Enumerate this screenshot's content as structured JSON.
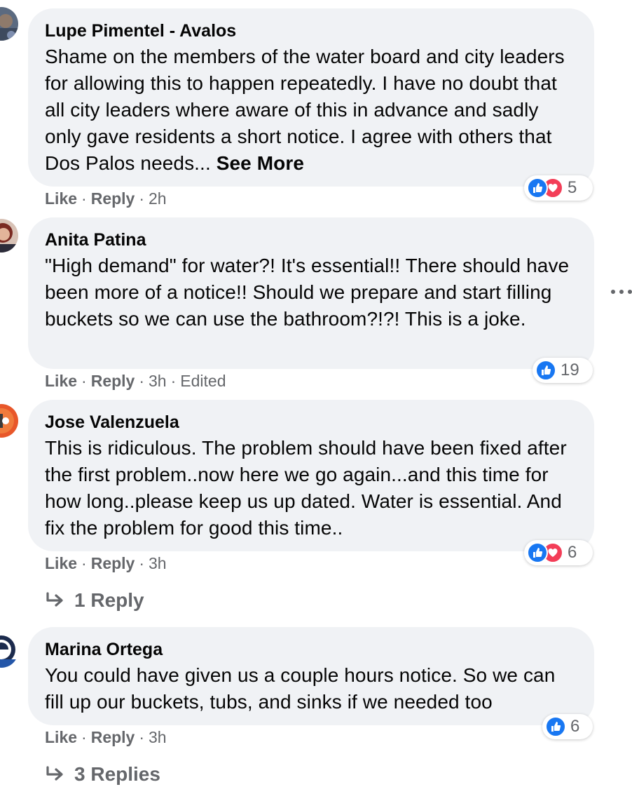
{
  "colors": {
    "bubble": "#f0f2f5",
    "meta_text": "#65676b",
    "like_blue": "#1877f2",
    "love_red": "#f33e58"
  },
  "comments": [
    {
      "author": "Lupe Pimentel - Avalos",
      "text": "Shame on the members of the water board and city leaders for allowing this to happen repeatedly. I have no doubt that all city leaders where aware of this in advance and sadly only gave residents a short notice. I agree with others that Dos Palos needs...",
      "see_more": "See More",
      "like": "Like",
      "reply": "Reply",
      "time": "2h",
      "reactions": [
        "like-icon",
        "love-icon"
      ],
      "reaction_count": "5"
    },
    {
      "author": "Anita Patina",
      "text": "\"High demand\" for water?! It's essential!! There should have been more of a notice!! Should we prepare and start filling buckets so we can use the bathroom?!?! This is a joke.",
      "like": "Like",
      "reply": "Reply",
      "time": "3h",
      "edited": "Edited",
      "reactions": [
        "like-icon"
      ],
      "reaction_count": "19"
    },
    {
      "author": "Jose Valenzuela",
      "text": "This is ridiculous. The problem should have been fixed after the first problem..now here we go again...and this time for how long..please keep us up dated. Water is essential. And fix the problem for good this time..",
      "like": "Like",
      "reply": "Reply",
      "time": "3h",
      "reactions": [
        "like-icon",
        "love-icon"
      ],
      "reaction_count": "6",
      "replies_label": "1 Reply"
    },
    {
      "author": "Marina Ortega",
      "text": "You could have given us a couple hours notice. So we can fill up our buckets, tubs, and sinks if we needed too",
      "like": "Like",
      "reply": "Reply",
      "time": "3h",
      "reactions": [
        "like-icon"
      ],
      "reaction_count": "6",
      "replies_label": "3 Replies"
    }
  ]
}
